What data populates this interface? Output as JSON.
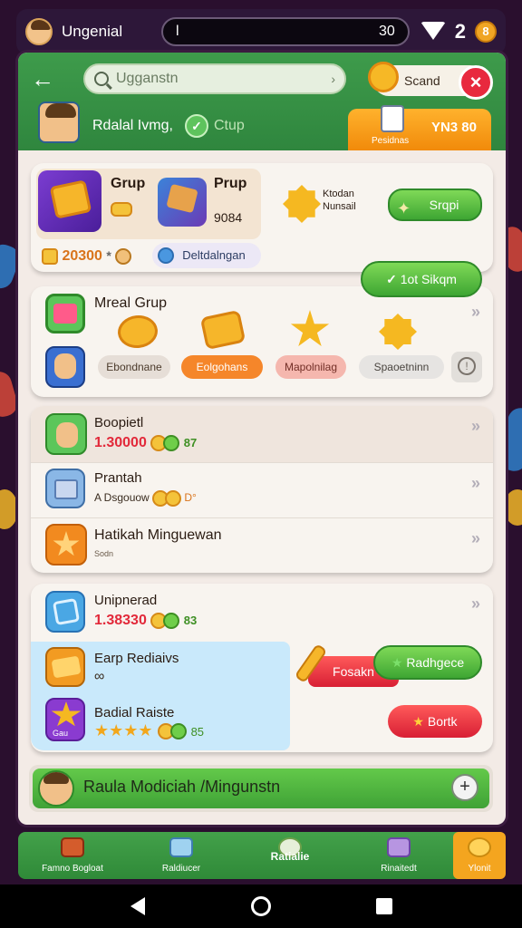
{
  "status_bar": {
    "title": "Ungenial",
    "field_value": "l",
    "field_count": "30",
    "count": "2",
    "coin_label": "8"
  },
  "header": {
    "search_placeholder": "Ugganstn",
    "sign_label": "Scand",
    "close_label": "×",
    "user_name": "Rdalal Ivmg,",
    "group_label": "Ctup",
    "wallet_amount": "YN3 80",
    "wallet_label": "Pesidnas"
  },
  "card1": {
    "item1_title": "Grup",
    "item2_title": "Prup",
    "item2_value": "9084",
    "score": "20300",
    "separator": "*",
    "badge_label": "Deltdalngan",
    "promo_line1": "Ktodan",
    "promo_line2": "Nunsail",
    "button_label": "Srqpi",
    "float_button": "1ot Sikqm"
  },
  "card2": {
    "title": "Mreal Grup",
    "chips": [
      "Ebondnane",
      "Eolgohans",
      "Mapolnilag",
      "Spaoetninn"
    ],
    "arrows": "»",
    "info_icon": "!"
  },
  "card3": {
    "rows": [
      {
        "title": "Boopietl",
        "value": "1.30000",
        "extra": "87",
        "arrows": "»"
      },
      {
        "title": "Prantah",
        "value": "A Dsgouow",
        "extra": "D°",
        "arrows": "»"
      },
      {
        "title": "Hatikah Minguewan",
        "value": "Sodn",
        "arrows": "»"
      }
    ]
  },
  "card4": {
    "title": "Unipnerad",
    "value": "1.38330",
    "extra": "83",
    "arrows": "»",
    "sub1_title": "Earp Rediaivs",
    "sub1_value": "∞",
    "sub2_title": "Badial Raiste",
    "sub2_stars": "★★★★",
    "sub2_extra": "85",
    "sub2_icon_label": "Gau",
    "red_label": "Fosakn",
    "green_button": "Radhgece",
    "red_button": "Bortk"
  },
  "bottom_bar": {
    "label": "Raula Modiciah /Mingunstn",
    "plus": "+"
  },
  "bottom_nav": [
    {
      "label": "Famno Bogloat"
    },
    {
      "label": "Raldiucer"
    },
    {
      "label": "Ratialie"
    },
    {
      "label": "Rinaitedt"
    },
    {
      "label": "Ylonit"
    }
  ],
  "colors": {
    "header_green": "#2f863e",
    "accent_orange": "#f18a0a",
    "danger_red": "#e8293e",
    "background": "#2a0f2e"
  }
}
